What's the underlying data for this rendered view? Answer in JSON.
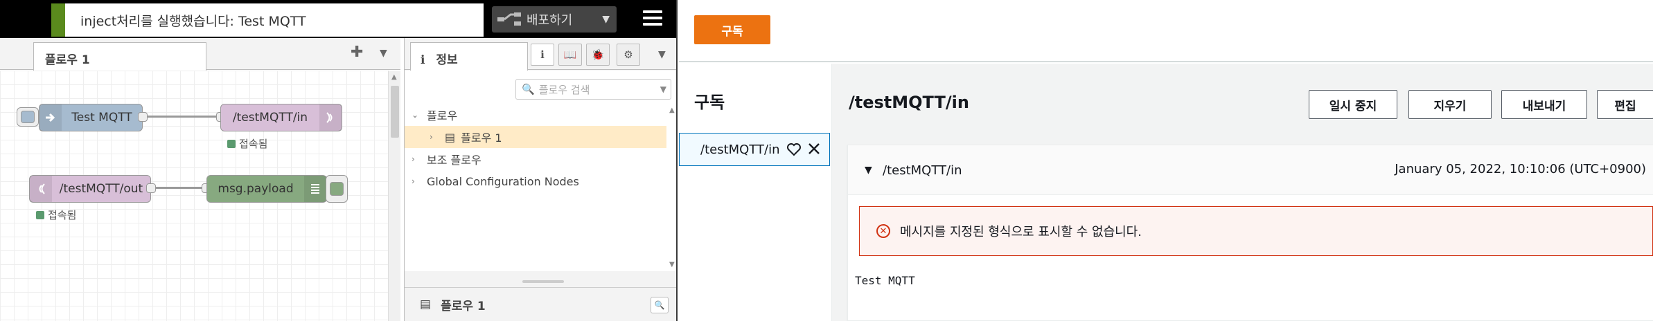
{
  "nodered": {
    "notification": "inject처리를 실행했습니다: Test MQTT",
    "deploy_label": "배포하기",
    "workspace_tab": "플로우 1",
    "nodes": {
      "inject_label": "Test MQTT",
      "mqtt_in_label": "/testMQTT/in",
      "mqtt_out_label": "/testMQTT/out",
      "debug_label": "msg.payload",
      "status_connected": "접속됨"
    },
    "sidebar": {
      "tab_label": "정보",
      "search_placeholder": "플로우 검색",
      "tree": {
        "flows": "플로우",
        "flow1": "플로우 1",
        "subflows": "보조 플로우",
        "global_config": "Global Configuration Nodes"
      },
      "footer_label": "플로우 1"
    }
  },
  "aws": {
    "subscribe_button": "구독",
    "left_title": "구독",
    "subscription_item": "/testMQTT/in",
    "main_title": "/testMQTT/in",
    "buttons": {
      "pause": "일시 중지",
      "clear": "지우기",
      "export": "내보내기",
      "edit": "편집"
    },
    "message": {
      "topic": "/testMQTT/in",
      "timestamp": "January 05, 2022, 10:10:06 (UTC+0900)",
      "error": "메시지를 지정된 형식으로 표시할 수 없습니다.",
      "body": "Test MQTT"
    }
  },
  "colors": {
    "nr_green": "#5a8a1d",
    "aws_orange": "#ec7211",
    "aws_blue": "#0073bb",
    "aws_red": "#d13212",
    "inject_node": "#a6bbcf",
    "mqtt_node": "#d8bfd8",
    "debug_node": "#87a980"
  }
}
